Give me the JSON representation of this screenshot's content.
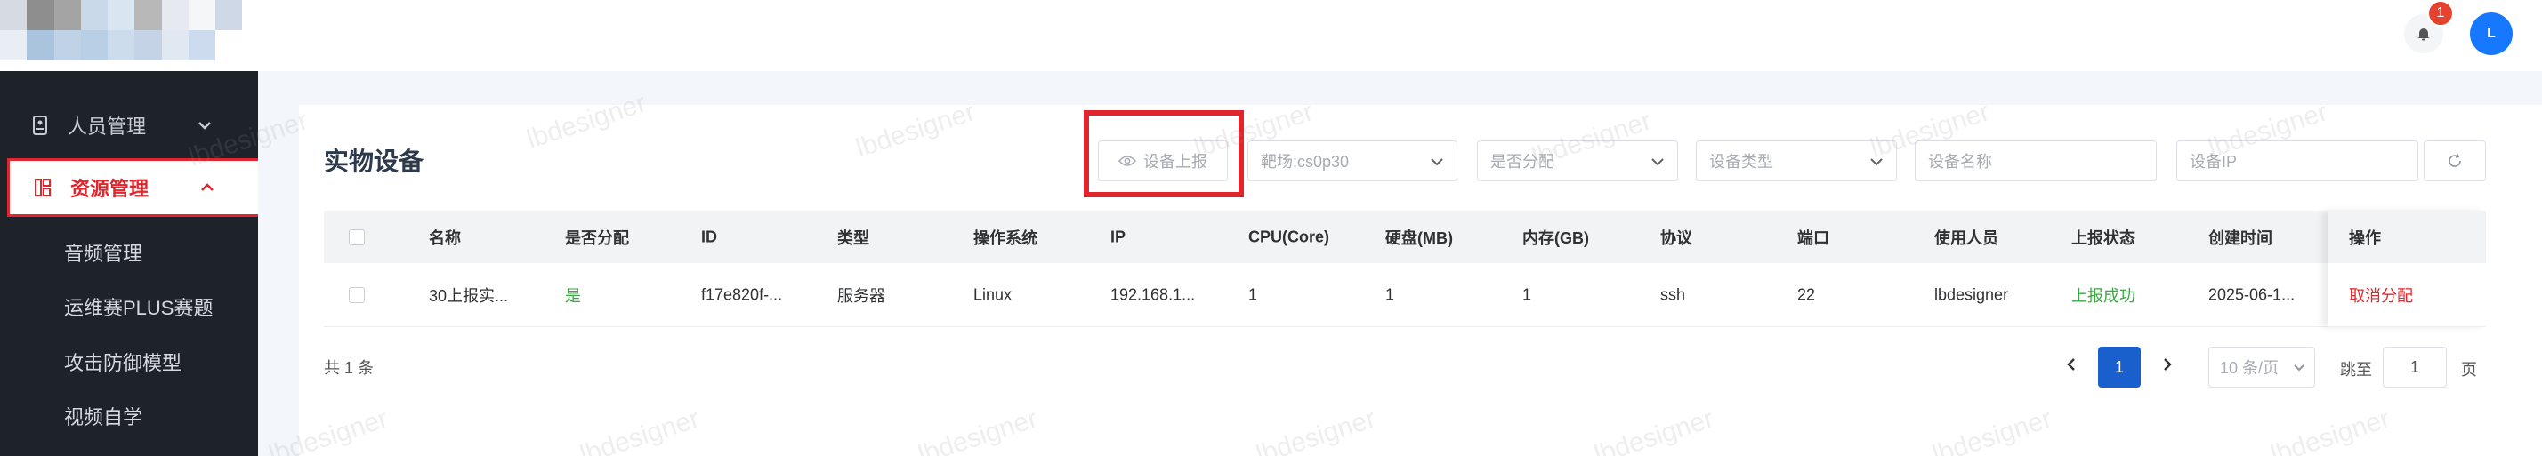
{
  "header": {
    "notification_count": "1",
    "avatar_initial": "L",
    "logo_colors": [
      "#d5dae3",
      "#8e8e8e",
      "#a4a4a4",
      "#c9d9ea",
      "#d9e5f1",
      "#b8b8b8",
      "#e6eaf0",
      "#f5f6f8",
      "#cfd8e6",
      "#fff",
      "#fff",
      "#fff",
      "#fff",
      "#fff",
      "#fff",
      "#e9eef5",
      "#aac4de",
      "#c0d2e6",
      "#b8cfe6",
      "#cddcec",
      "#c4d4e6",
      "#e0e8f2",
      "#ccdcee",
      "#fff",
      "#fff",
      "#fff",
      "#fff",
      "#fff",
      "#fff",
      "#fff"
    ]
  },
  "sidebar": {
    "groups": [
      {
        "label": "人员管理",
        "icon": "id-badge-icon"
      },
      {
        "label": "资源管理",
        "icon": "resource-grid-icon"
      }
    ],
    "subitems": [
      "音频管理",
      "运维赛PLUS赛题",
      "攻击防御模型",
      "视频自学"
    ]
  },
  "main": {
    "title": "实物设备",
    "report_button": "设备上报",
    "filters": {
      "range_select": "靶场:cs0p30",
      "assigned_placeholder": "是否分配",
      "type_placeholder": "设备类型",
      "name_placeholder": "设备名称",
      "ip_placeholder": "设备IP"
    },
    "table": {
      "columns": [
        "名称",
        "是否分配",
        "ID",
        "类型",
        "操作系统",
        "IP",
        "CPU(Core)",
        "硬盘(MB)",
        "内存(GB)",
        "协议",
        "端口",
        "使用人员",
        "上报状态",
        "创建时间",
        "操作"
      ],
      "rows": [
        [
          "30上报实...",
          "是",
          "f17e820f-...",
          "服务器",
          "Linux",
          "192.168.1...",
          "1",
          "1",
          "1",
          "ssh",
          "22",
          "lbdesigner",
          "上报成功",
          "2025-06-1...",
          "取消分配"
        ]
      ]
    },
    "pagination": {
      "total": "共 1 条",
      "current_page": "1",
      "page_size": "10 条/页",
      "jump_label": "跳至",
      "jump_value": "1",
      "jump_suffix": "页"
    }
  },
  "watermark_text": "lbdesigner",
  "colors": {
    "accent_red": "#e0252c",
    "primary_blue": "#1a5fce",
    "success_green": "#3aa842",
    "sidebar_bg": "#1d2329"
  }
}
